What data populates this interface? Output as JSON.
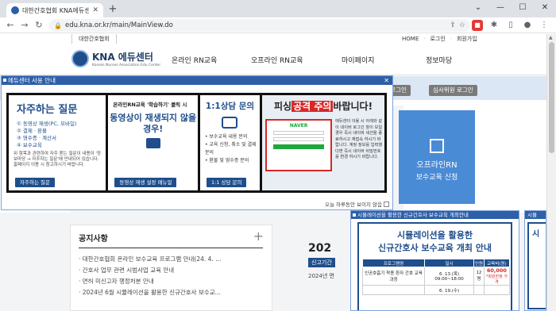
{
  "browser": {
    "tab_title": "대한간호협회 KNA에듀센터 (교",
    "url": "edu.kna.or.kr/main/MainView.do"
  },
  "util": {
    "left": "대한간호협회",
    "home": "HOME",
    "login": "로그인",
    "signup": "회원가입"
  },
  "header": {
    "logo_text": "KNA 에듀센터",
    "logo_sub": "Korean Nurses Association Edu Center",
    "gnb": [
      "온라인 RN교육",
      "오프라인 RN교육",
      "마이페이지",
      "정보마당"
    ]
  },
  "logins": {
    "agency": "기관 로그인",
    "reviewer": "심사위원 로그인"
  },
  "offline_card": {
    "line1": "오프라인RN",
    "line2": "보수교육 신청"
  },
  "notice": {
    "title": "공지사항",
    "items": [
      "대한간호협회 온라인 보수교육 프로그램 안내(24. 4. ...",
      "간호사 업무 관련 시범사업 교육 안내",
      "면허 미신고자 행정처분 안내",
      "2024년 6월 시뮬레이션을 활용한 신규간호사 보수교..."
    ]
  },
  "promo": {
    "year": "202",
    "tag": "신고기간",
    "sub": "2024년 면"
  },
  "popup1": {
    "title": "에듀센터 사용 안내",
    "faq_title": "자주하는 질문",
    "faq_list": [
      "① 동영상 재생(PC, 모바일)",
      "② 결제 · 환불",
      "③ 영수증 · 계산서",
      "④ 보수교육"
    ],
    "faq_desc": "위 항목과 관련하여 자주 묻는 질문이 내용이 '정보마당 → 자주하는 질문'에 안내되어 있습니다. 홈페이지 이용 시 참고하시기 바랍니다.",
    "faq_button": "자주하는 질문",
    "video_top": "온라인RN교육 '학습하기' 클릭 시",
    "video_main": "동영상이 재생되지 않을 경우!",
    "video_button": "동영상 재생 설정 매뉴얼",
    "qa_title": "1:1상담 문의",
    "qa_list": [
      "• 보수교육 내용 문의",
      "• 교육 신청, 취소 및 결제 문의",
      "• 환불 및 영수증 문의"
    ],
    "qa_button": "1:1 상담 문의",
    "phishing_pre": "피싱",
    "phishing_red": "공격 주의",
    "phishing_post": "바랍니다!",
    "naver": "NAVER",
    "phishing_desc": "에듀센터 이용 시 아래와 같이 네이버 로그인 창이 보일 경우 즉시 네이버 세션을 종료하시고 재접속 하시기 바랍니다. 계정 정보를 입력했다면 즉시 네이버 비밀번호를 변경 하시기 바랍니다.",
    "footer": "오늘 하루동안 보이지 않음"
  },
  "popup2": {
    "title": "시뮬레이션을 활용한 신규간호사 보수교육 개최안내",
    "heading1": "시뮬레이션을 활용한",
    "heading2": "신규간호사 보수교육 개최 안내",
    "table_headers": [
      "프로그램명",
      "일시",
      "인원",
      "교육비(원)"
    ],
    "rows": [
      {
        "name": "인공호흡기 착용 환자 간호 교육과정",
        "date": "6. 13.(목) 09:00~18:00",
        "seats": "12명",
        "fee": "60,000"
      },
      {
        "name": "",
        "date": "6. 19.(수)",
        "seats": "",
        "fee": ""
      }
    ],
    "fee_note": "*회원한정 가격"
  },
  "popup3": {
    "title": "시뮬",
    "body": "시"
  }
}
